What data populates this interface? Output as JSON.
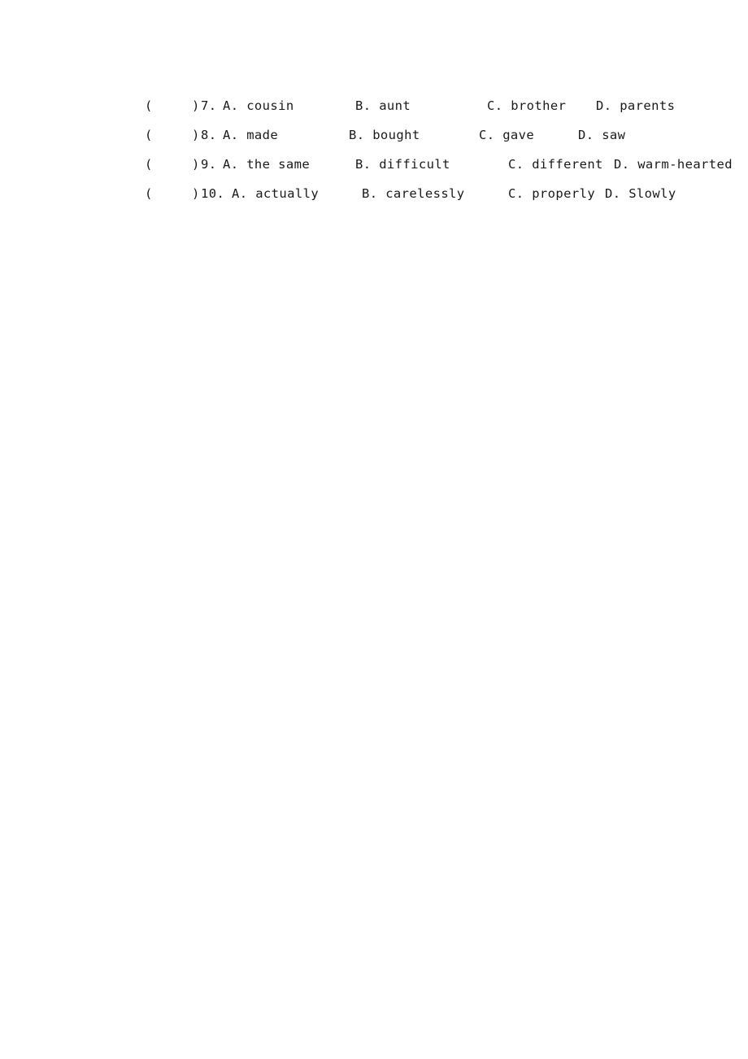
{
  "page": {
    "background_color": "#ffffff",
    "text_color": "#1a1a1a"
  },
  "questions": [
    {
      "paren_open": "(",
      "paren_close": ")",
      "number": "7.",
      "options": {
        "a": "A. cousin",
        "b": "B. aunt",
        "c": "C. brother",
        "d": "D. parents"
      }
    },
    {
      "paren_open": "(",
      "paren_close": ")",
      "number": "8.",
      "options": {
        "a": "A. made",
        "b": "B. bought",
        "c": "C. gave",
        "d": "D. saw"
      }
    },
    {
      "paren_open": "(",
      "paren_close": ")",
      "number": "9.",
      "options": {
        "a": "A. the same",
        "b": "B. difficult",
        "c": "C. different",
        "d": "D. warm-hearted"
      }
    },
    {
      "paren_open": "(",
      "paren_close": ")",
      "number": "10.",
      "options": {
        "a": "A. actually",
        "b": "B. carelessly",
        "c": "C. properly",
        "d": "D. Slowly"
      }
    }
  ]
}
